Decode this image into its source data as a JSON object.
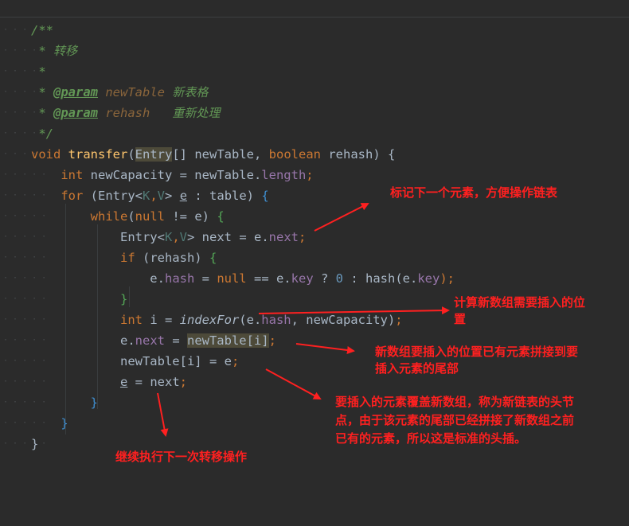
{
  "code": {
    "lines": [
      {
        "dots": "· · · · ·",
        "tokens": [
          {
            "t": "/**",
            "c": "c-comment"
          }
        ]
      },
      {
        "dots": "· · · · ·",
        "tokens": [
          {
            "t": " * ",
            "c": "c-comment"
          },
          {
            "t": "转移",
            "c": "c-comment-cn"
          }
        ]
      },
      {
        "dots": "· · · · ·",
        "tokens": [
          {
            "t": " *",
            "c": "c-comment"
          }
        ]
      },
      {
        "dots": "· · · · ·",
        "tokens": [
          {
            "t": " * ",
            "c": "c-comment"
          },
          {
            "t": "@param",
            "c": "c-tag"
          },
          {
            "t": " newTable ",
            "c": "c-param"
          },
          {
            "t": "新表格",
            "c": "c-comment-cn"
          }
        ]
      },
      {
        "dots": "· · · · ·",
        "tokens": [
          {
            "t": " * ",
            "c": "c-comment"
          },
          {
            "t": "@param",
            "c": "c-tag"
          },
          {
            "t": " rehash   ",
            "c": "c-param"
          },
          {
            "t": "重新处理",
            "c": "c-comment-cn"
          }
        ]
      },
      {
        "dots": "· · · · ·",
        "tokens": [
          {
            "t": " */",
            "c": "c-comment"
          }
        ]
      },
      {
        "dots": "· · · · ·",
        "tokens": [
          {
            "t": "void ",
            "c": "c-keyword"
          },
          {
            "t": "transfer",
            "c": "c-method"
          },
          {
            "t": "(",
            "c": "c-plain"
          },
          {
            "t": "Entry",
            "c": "c-plain hl"
          },
          {
            "t": "[] newTable, ",
            "c": "c-plain"
          },
          {
            "t": "boolean ",
            "c": "c-keyword"
          },
          {
            "t": "rehash) {",
            "c": "c-plain"
          }
        ]
      },
      {
        "dots": "· · · · ·",
        "tokens": [
          {
            "t": "    int ",
            "c": "c-keyword"
          },
          {
            "t": "newCapacity = newTable.",
            "c": "c-plain"
          },
          {
            "t": "length",
            "c": "c-field"
          },
          {
            "t": ";",
            "c": "c-keyword"
          }
        ]
      },
      {
        "dots": "· · · · ·",
        "tokens": [
          {
            "t": "    for ",
            "c": "c-keyword"
          },
          {
            "t": "(Entry<",
            "c": "c-plain"
          },
          {
            "t": "K",
            "c": "c-type"
          },
          {
            "t": ",",
            "c": "c-keyword"
          },
          {
            "t": "V",
            "c": "c-type"
          },
          {
            "t": "> ",
            "c": "c-plain"
          },
          {
            "t": "e",
            "c": "c-plain ul"
          },
          {
            "t": " : table) ",
            "c": "c-plain"
          },
          {
            "t": "{",
            "c": "c-brace-b"
          }
        ]
      },
      {
        "dots": "· · · · ·",
        "tokens": [
          {
            "t": "        while",
            "c": "c-keyword"
          },
          {
            "t": "(",
            "c": "c-plain"
          },
          {
            "t": "null ",
            "c": "c-keyword"
          },
          {
            "t": "!= e) ",
            "c": "c-plain"
          },
          {
            "t": "{",
            "c": "c-brace-g"
          }
        ]
      },
      {
        "dots": "· · · · ·",
        "tokens": [
          {
            "t": "            Entry<",
            "c": "c-plain"
          },
          {
            "t": "K",
            "c": "c-type"
          },
          {
            "t": ",",
            "c": "c-keyword"
          },
          {
            "t": "V",
            "c": "c-type"
          },
          {
            "t": "> next = e.",
            "c": "c-plain"
          },
          {
            "t": "next",
            "c": "c-field"
          },
          {
            "t": ";",
            "c": "c-keyword"
          }
        ]
      },
      {
        "dots": "· · · · ·",
        "tokens": [
          {
            "t": "            if ",
            "c": "c-keyword"
          },
          {
            "t": "(rehash) ",
            "c": "c-plain"
          },
          {
            "t": "{",
            "c": "c-brace-g"
          }
        ]
      },
      {
        "dots": "· · · · ·",
        "tokens": [
          {
            "t": "                e.",
            "c": "c-plain"
          },
          {
            "t": "hash",
            "c": "c-field"
          },
          {
            "t": " = ",
            "c": "c-plain"
          },
          {
            "t": "null ",
            "c": "c-keyword"
          },
          {
            "t": "== e.",
            "c": "c-plain"
          },
          {
            "t": "key",
            "c": "c-field"
          },
          {
            "t": " ? ",
            "c": "c-plain"
          },
          {
            "t": "0",
            "c": "c-number"
          },
          {
            "t": " : hash(e.",
            "c": "c-plain"
          },
          {
            "t": "key",
            "c": "c-field"
          },
          {
            "t": ");",
            "c": "c-keyword"
          }
        ]
      },
      {
        "dots": "· · · · ·",
        "tokens": [
          {
            "t": "            }",
            "c": "c-brace-g"
          }
        ]
      },
      {
        "dots": "· · · · ·",
        "tokens": [
          {
            "t": "            int ",
            "c": "c-keyword"
          },
          {
            "t": "i = ",
            "c": "c-plain"
          },
          {
            "t": "indexFor",
            "c": "c-italic"
          },
          {
            "t": "(e.",
            "c": "c-plain"
          },
          {
            "t": "hash",
            "c": "c-field"
          },
          {
            "t": ", newCapacity)",
            "c": "c-plain"
          },
          {
            "t": ";",
            "c": "c-keyword"
          }
        ]
      },
      {
        "dots": "· · · · ·",
        "tokens": [
          {
            "t": "            e.",
            "c": "c-plain"
          },
          {
            "t": "next",
            "c": "c-field"
          },
          {
            "t": " = ",
            "c": "c-plain"
          },
          {
            "t": "newTable[i]",
            "c": "c-plain hl"
          },
          {
            "t": ";",
            "c": "c-keyword"
          }
        ]
      },
      {
        "dots": "· · · · ·",
        "tokens": [
          {
            "t": "            newTable[i] = e",
            "c": "c-plain"
          },
          {
            "t": ";",
            "c": "c-keyword"
          }
        ]
      },
      {
        "dots": "· · · · ·",
        "tokens": [
          {
            "t": "            ",
            "c": "c-plain"
          },
          {
            "t": "e",
            "c": "c-plain ul"
          },
          {
            "t": " = next",
            "c": "c-plain"
          },
          {
            "t": ";",
            "c": "c-keyword"
          }
        ]
      },
      {
        "dots": "· · · · ·",
        "tokens": [
          {
            "t": "        }",
            "c": "c-brace-b"
          }
        ]
      },
      {
        "dots": "· · · · ·",
        "tokens": [
          {
            "t": "    }",
            "c": "c-brace-b"
          }
        ]
      },
      {
        "dots": "· · · · ·",
        "tokens": [
          {
            "t": "}",
            "c": "c-plain"
          }
        ]
      }
    ]
  },
  "annotations": {
    "mark_next": "标记下一个元素，方便操作链表",
    "calc_pos_1": "计算新数组需要插入的位",
    "calc_pos_2": "置",
    "splice_1": "新数组要插入的位置已有元素拼接到要",
    "splice_2": "插入元素的尾部",
    "head_1": "要插入的元素覆盖新数组，称为新链表的头节",
    "head_2": "点，由于该元素的尾部已经拼接了新数组之前",
    "head_3": "已有的元素，所以这是标准的头插。",
    "continue": "继续执行下一次转移操作"
  },
  "colors": {
    "background": "#2b2b2b",
    "annotation": "#ff2020",
    "keyword": "#cc7832",
    "comment": "#629755",
    "field": "#9876aa"
  }
}
